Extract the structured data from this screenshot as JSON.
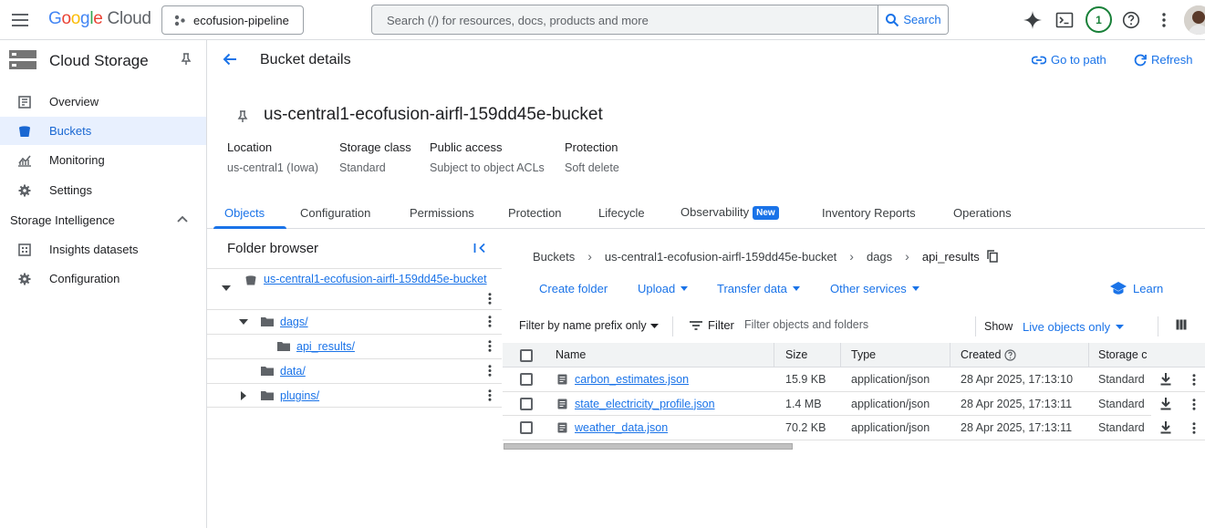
{
  "topbar": {
    "logo_google": [
      "G",
      "o",
      "o",
      "g",
      "l",
      "e"
    ],
    "logo_cloud": "Cloud",
    "project": "ecofusion-pipeline",
    "search_placeholder": "Search (/) for resources, docs, products and more",
    "search_button": "Search",
    "notifications": "1",
    "icons": [
      "menu-icon",
      "project-icon",
      "search-icon",
      "gemini-icon",
      "terminal-icon",
      "help-icon",
      "more-vert-icon"
    ]
  },
  "leftnav": {
    "product": "Cloud Storage",
    "items": [
      {
        "label": "Overview",
        "icon": "overview-icon",
        "active": false
      },
      {
        "label": "Buckets",
        "icon": "bucket-icon",
        "active": true
      },
      {
        "label": "Monitoring",
        "icon": "monitoring-icon",
        "active": false
      },
      {
        "label": "Settings",
        "icon": "settings-icon",
        "active": false
      }
    ],
    "section": "Storage Intelligence",
    "section_items": [
      {
        "label": "Insights datasets",
        "icon": "insights-icon"
      },
      {
        "label": "Configuration",
        "icon": "settings-icon"
      }
    ]
  },
  "header": {
    "title": "Bucket details",
    "goto_path": "Go to path",
    "refresh": "Refresh"
  },
  "bucket": {
    "name": "us-central1-ecofusion-airfl-159dd45e-bucket",
    "props": [
      {
        "key": "Location",
        "value": "us-central1 (Iowa)"
      },
      {
        "key": "Storage class",
        "value": "Standard"
      },
      {
        "key": "Public access",
        "value": "Subject to object ACLs"
      },
      {
        "key": "Protection",
        "value": "Soft delete"
      }
    ]
  },
  "tabs": {
    "items": [
      "Objects",
      "Configuration",
      "Permissions",
      "Protection",
      "Lifecycle",
      "Observability",
      "Inventory Reports",
      "Operations"
    ],
    "active": "Objects",
    "new_badge": "New"
  },
  "folder_browser": {
    "title": "Folder browser",
    "root": "us-central1-ecofusion-airfl-159dd45e-bucket",
    "nodes": [
      {
        "name": "dags/",
        "expanded": true
      },
      {
        "name": "api_results/"
      },
      {
        "name": "data/"
      },
      {
        "name": "plugins/",
        "expanded": false
      }
    ]
  },
  "breadcrumb": [
    "Buckets",
    "us-central1-ecofusion-airfl-159dd45e-bucket",
    "dags",
    "api_results"
  ],
  "actions": {
    "create_folder": "Create folder",
    "upload": "Upload",
    "transfer": "Transfer data",
    "other": "Other services",
    "learn": "Learn"
  },
  "filter": {
    "prefix": "Filter by name prefix only",
    "filter_label": "Filter",
    "placeholder": "Filter objects and folders",
    "show_label": "Show",
    "show_value": "Live objects only"
  },
  "table": {
    "headers": {
      "name": "Name",
      "size": "Size",
      "type": "Type",
      "created": "Created",
      "storage": "Storage c"
    },
    "rows": [
      {
        "name": "carbon_estimates.json",
        "size": "15.9 KB",
        "type": "application/json",
        "created": "28 Apr 2025, 17:13:10",
        "storage": "Standard"
      },
      {
        "name": "state_electricity_profile.json",
        "size": "1.4 MB",
        "type": "application/json",
        "created": "28 Apr 2025, 17:13:11",
        "storage": "Standard"
      },
      {
        "name": "weather_data.json",
        "size": "70.2 KB",
        "type": "application/json",
        "created": "28 Apr 2025, 17:13:11",
        "storage": "Standard"
      }
    ]
  }
}
